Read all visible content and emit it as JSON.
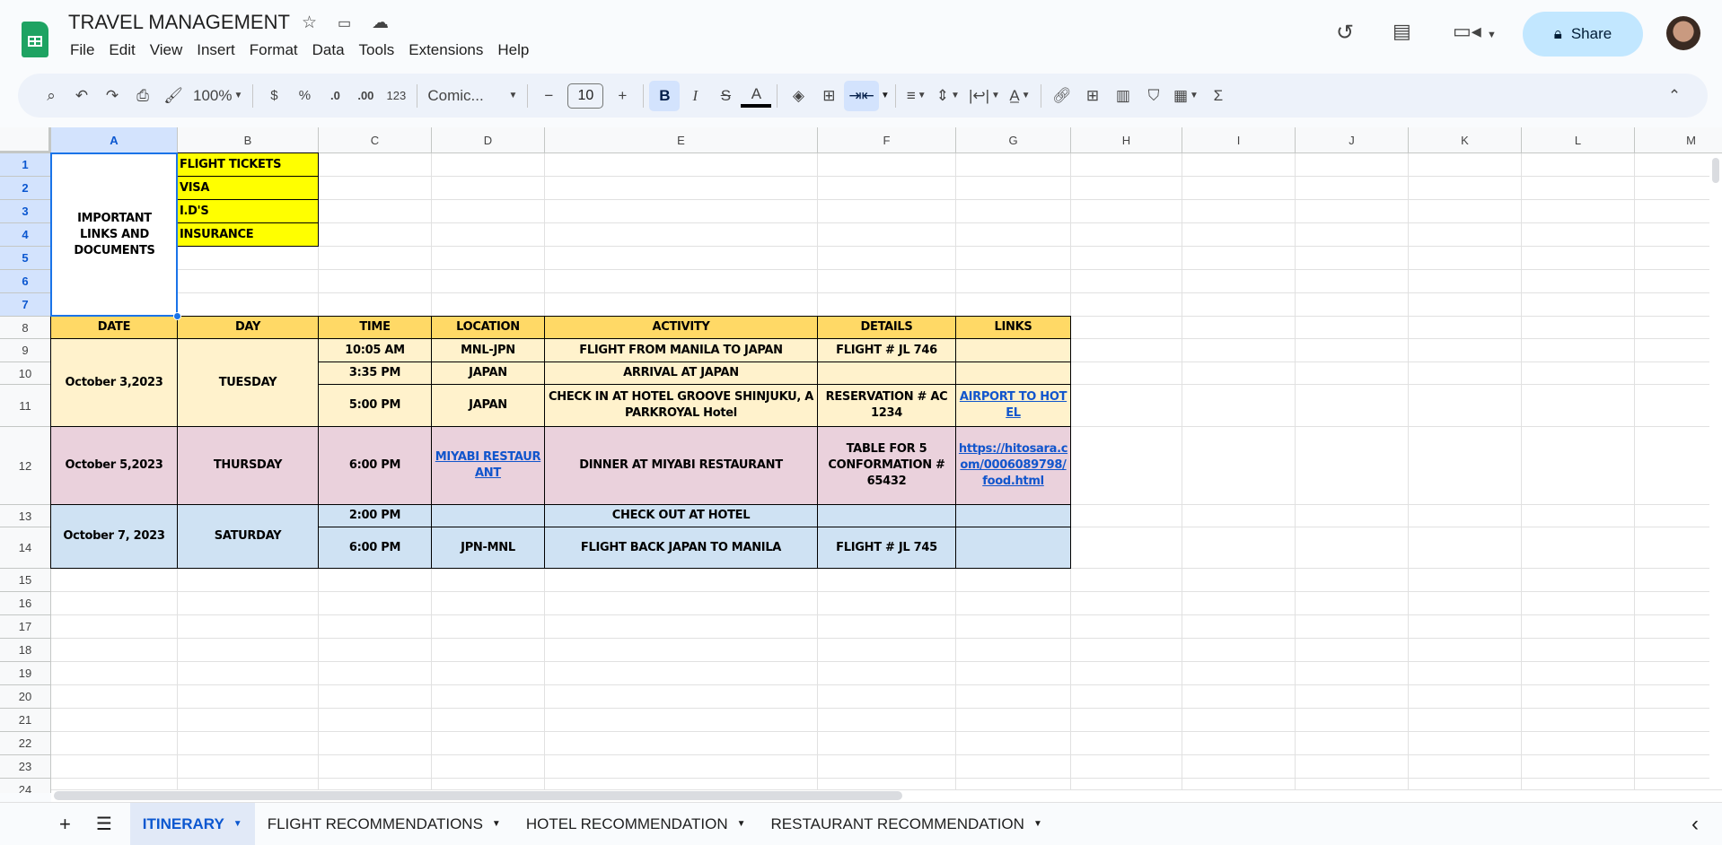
{
  "app": {
    "title": "TRAVEL MANAGEMENT",
    "title_icons": [
      "star-icon",
      "move-folder-icon",
      "cloud-saved-icon"
    ],
    "menu": [
      "File",
      "Edit",
      "View",
      "Insert",
      "Format",
      "Data",
      "Tools",
      "Extensions",
      "Help"
    ],
    "share_label": "Share",
    "right_icons": [
      "history-icon",
      "comment-icon",
      "video-call-icon"
    ]
  },
  "toolbar": {
    "zoom": "100%",
    "currency": "$",
    "percent": "%",
    "decrease_decimal": ".0",
    "increase_decimal": ".00",
    "number_format": "123",
    "font": "Comic...",
    "font_size": "10",
    "bold": "B",
    "italic": "I",
    "text_color": "A",
    "sum": "Σ"
  },
  "columns": [
    "A",
    "B",
    "C",
    "D",
    "E",
    "F",
    "G",
    "H",
    "I",
    "J",
    "K",
    "L",
    "M"
  ],
  "rows": [
    "1",
    "2",
    "3",
    "4",
    "5",
    "6",
    "7",
    "8",
    "9",
    "10",
    "11",
    "12",
    "13",
    "14",
    "15",
    "16",
    "17",
    "18",
    "19",
    "20",
    "21",
    "22",
    "23",
    "24"
  ],
  "selected": {
    "range": "A1:A7",
    "column": "A"
  },
  "colors": {
    "yellow": "#ffff00",
    "header": "#ffd966",
    "oct3": "#fff2cc",
    "oct5": "#ead1dc",
    "oct7": "#cfe2f3",
    "link": "#1155cc",
    "accent": "#0b57d0"
  },
  "cells": [
    {
      "range": "A1:A7",
      "text": "IMPORTANT LINKS AND DOCUMENTS",
      "fill": "#ffffff",
      "noborder": true
    },
    {
      "range": "B1",
      "text": "FLIGHT TICKETS",
      "fill": "#ffff00",
      "align": "left"
    },
    {
      "range": "B2",
      "text": "VISA",
      "fill": "#ffff00",
      "align": "left"
    },
    {
      "range": "B3",
      "text": "I.D'S",
      "fill": "#ffff00",
      "align": "left"
    },
    {
      "range": "B4",
      "text": "INSURANCE",
      "fill": "#ffff00",
      "align": "left"
    },
    {
      "range": "A8",
      "text": "DATE",
      "fill": "#ffd966"
    },
    {
      "range": "B8",
      "text": "DAY",
      "fill": "#ffd966"
    },
    {
      "range": "C8",
      "text": "TIME",
      "fill": "#ffd966"
    },
    {
      "range": "D8",
      "text": "LOCATION",
      "fill": "#ffd966"
    },
    {
      "range": "E8",
      "text": "ACTIVITY",
      "fill": "#ffd966"
    },
    {
      "range": "F8",
      "text": "DETAILS",
      "fill": "#ffd966"
    },
    {
      "range": "G8",
      "text": "LINKS",
      "fill": "#ffd966"
    },
    {
      "range": "A9:A11",
      "text": "October 3,2023",
      "fill": "#fff2cc"
    },
    {
      "range": "B9:B11",
      "text": "TUESDAY",
      "fill": "#fff2cc"
    },
    {
      "range": "C9",
      "text": "10:05 AM",
      "fill": "#fff2cc"
    },
    {
      "range": "D9",
      "text": "MNL-JPN",
      "fill": "#fff2cc"
    },
    {
      "range": "E9",
      "text": "FLIGHT FROM MANILA TO JAPAN",
      "fill": "#fff2cc"
    },
    {
      "range": "F9",
      "text": "FLIGHT # JL 746",
      "fill": "#fff2cc"
    },
    {
      "range": "G9",
      "text": "",
      "fill": "#fff2cc"
    },
    {
      "range": "C10",
      "text": "3:35 PM",
      "fill": "#fff2cc"
    },
    {
      "range": "D10",
      "text": "JAPAN",
      "fill": "#fff2cc"
    },
    {
      "range": "E10",
      "text": "ARRIVAL AT JAPAN",
      "fill": "#fff2cc"
    },
    {
      "range": "F10",
      "text": "",
      "fill": "#fff2cc"
    },
    {
      "range": "G10",
      "text": "",
      "fill": "#fff2cc"
    },
    {
      "range": "C11",
      "text": "5:00 PM",
      "fill": "#fff2cc"
    },
    {
      "range": "D11",
      "text": "JAPAN",
      "fill": "#fff2cc"
    },
    {
      "range": "E11",
      "text": "CHECK IN AT HOTEL GROOVE SHINJUKU, A PARKROYAL Hotel",
      "fill": "#fff2cc"
    },
    {
      "range": "F11",
      "text": "RESERVATION # AC 1234",
      "fill": "#fff2cc"
    },
    {
      "range": "G11",
      "text": "AIRPORT TO HOTEL",
      "fill": "#fff2cc",
      "link": true
    },
    {
      "range": "A12",
      "text": "October 5,2023",
      "fill": "#ead1dc"
    },
    {
      "range": "B12",
      "text": "THURSDAY",
      "fill": "#ead1dc"
    },
    {
      "range": "C12",
      "text": "6:00 PM",
      "fill": "#ead1dc"
    },
    {
      "range": "D12",
      "text": "MIYABI RESTAURANT",
      "fill": "#ead1dc",
      "link": true
    },
    {
      "range": "E12",
      "text": "DINNER AT MIYABI RESTAURANT",
      "fill": "#ead1dc"
    },
    {
      "range": "F12",
      "text": "TABLE FOR 5 CONFORMATION # 65432",
      "fill": "#ead1dc"
    },
    {
      "range": "G12",
      "text": "https://hitosara.com/0006089798/food.html",
      "fill": "#ead1dc",
      "link": true
    },
    {
      "range": "A13:A14",
      "text": "October 7, 2023",
      "fill": "#cfe2f3"
    },
    {
      "range": "B13:B14",
      "text": "SATURDAY",
      "fill": "#cfe2f3"
    },
    {
      "range": "C13",
      "text": "2:00 PM",
      "fill": "#cfe2f3"
    },
    {
      "range": "D13",
      "text": "",
      "fill": "#cfe2f3"
    },
    {
      "range": "E13",
      "text": "CHECK OUT AT HOTEL",
      "fill": "#cfe2f3"
    },
    {
      "range": "F13",
      "text": "",
      "fill": "#cfe2f3"
    },
    {
      "range": "G13",
      "text": "",
      "fill": "#cfe2f3"
    },
    {
      "range": "C14",
      "text": "6:00 PM",
      "fill": "#cfe2f3"
    },
    {
      "range": "D14",
      "text": "JPN-MNL",
      "fill": "#cfe2f3"
    },
    {
      "range": "E14",
      "text": "FLIGHT BACK JAPAN TO MANILA",
      "fill": "#cfe2f3"
    },
    {
      "range": "F14",
      "text": "FLIGHT # JL 745",
      "fill": "#cfe2f3"
    },
    {
      "range": "G14",
      "text": "",
      "fill": "#cfe2f3"
    }
  ],
  "sheet_tabs": [
    {
      "label": "ITINERARY",
      "active": true
    },
    {
      "label": "FLIGHT RECOMMENDATIONS",
      "active": false
    },
    {
      "label": "HOTEL RECOMMENDATION",
      "active": false
    },
    {
      "label": "RESTAURANT RECOMMENDATION",
      "active": false
    }
  ],
  "bottom": {
    "add": "+",
    "menu": "☰",
    "collapse": "‹"
  }
}
